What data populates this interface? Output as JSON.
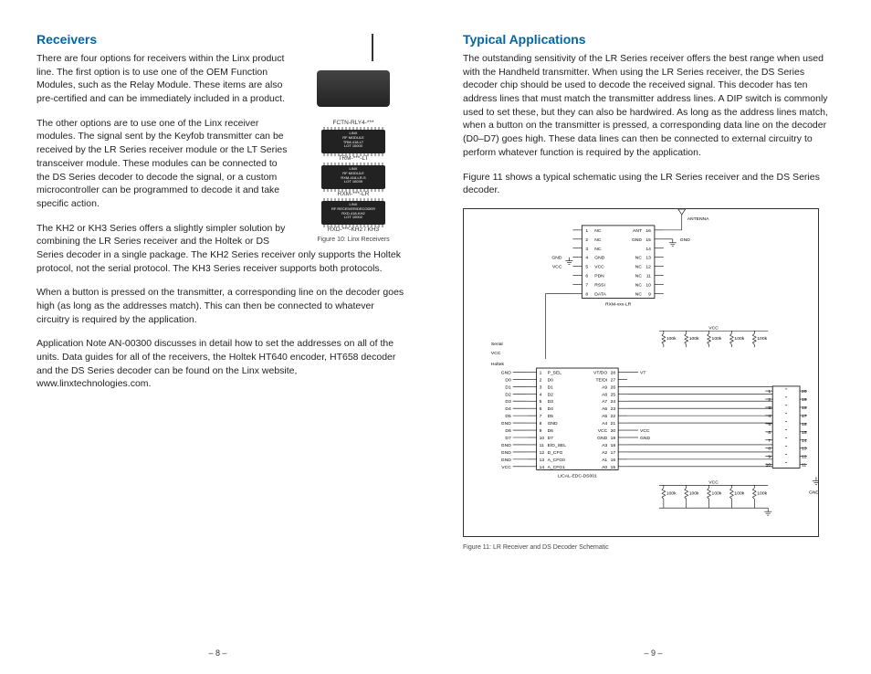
{
  "left": {
    "heading": "Receivers",
    "p1": "There are four options for receivers within the Linx product line. The first option is to use one of the OEM Function Modules, such as the Relay Module. These items are also pre-certified and can be immediately included in a product.",
    "p2": "The other options are to use one of the Linx receiver modules. The signal sent by the Keyfob transmitter can be received by the LR Series receiver module or the LT Series transceiver module. These modules can be connected to the DS Series decoder to decode the signal, or a custom microcontroller can be programmed to decode it and take specific action.",
    "p3": "The KH2 or KH3 Series offers a slightly simpler solution by combining the LR Series receiver and the Holtek or DS Series decoder in a single package. The KH2 Series receiver only supports the Holtek protocol, not the serial protocol. The KH3 Series receiver supports both protocols.",
    "p4": "When a button is pressed on the transmitter, a corresponding line on the decoder goes high (as long as the addresses match). This can then be connected to whatever circuitry is required by the application.",
    "p5": "Application Note AN-00300 discusses in detail how to set the addresses on all of the units. Data guides for all of the receivers, the Holtek HT640 encoder, HT658 decoder and the DS Series decoder can be found on the Linx website, www.linxtechnologies.com.",
    "fig10": {
      "caption": "Figure 10: Linx Receivers",
      "labels": {
        "device": "FCTN-RLY4-***",
        "chip1": "TRM-***-LT",
        "chip1_text": "LINX\nRF MODULE\nTRM-418-LT\nLOT 10000",
        "chip2": "RXM-***-LR",
        "chip2_text": "LINX\nRF MODULE\nRXM-418-LR-S\nLOT 10039",
        "chip3": "RXD-***-KH2 / KH3",
        "chip3_text": "LINX\nRF RECEIVER/DECODER\nRXD-418-KH2\nLOT 10002"
      }
    },
    "pagenum": "– 8 –"
  },
  "right": {
    "heading": "Typical Applications",
    "p1": "The outstanding sensitivity of the LR Series receiver offers the best range when used with the Handheld transmitter. When using the LR Series receiver, the DS Series decoder chip should be used to decode the received signal. This decoder has ten address lines that must match the transmitter address lines. A DIP switch is commonly used to set these, but they can also be hardwired. As long as the address lines match, when a button on the transmitter is pressed, a corresponding data line on the decoder (D0–D7) goes high. These data lines can then be connected to external circuitry to perform whatever function is required by the application.",
    "p2": "Figure 11 shows a typical schematic using the LR Series receiver and the DS Series decoder.",
    "fig11": {
      "caption": "Figure 11: LR Receiver and DS Decoder Schematic",
      "rx_chip": "RXM-xxx-LR",
      "rx_pins_left": [
        "NC",
        "NC",
        "NC",
        "GND",
        "VCC",
        "PDN",
        "RSSI",
        "DATA"
      ],
      "rx_pins_left_nums": [
        "1",
        "2",
        "3",
        "4",
        "5",
        "6",
        "7",
        "8"
      ],
      "rx_pins_right": [
        "ANT",
        "GND",
        "",
        "NC",
        "NC",
        "NC",
        "NC",
        "NC"
      ],
      "rx_pins_right_nums": [
        "16",
        "15",
        "14",
        "13",
        "12",
        "11",
        "10",
        "9"
      ],
      "rx_ext_left_labels": [
        "",
        "",
        "",
        "GND",
        "VCC",
        "",
        "",
        ""
      ],
      "rx_ext_right_label_ant": "ANTENNA",
      "rx_ext_right_label_gnd": "GND",
      "decoder_chip": "LICAL-EDC-DS001",
      "decoder_ext_header_serial": "Serial",
      "decoder_ext_header_holtek": "Holtek",
      "decoder_ext_left": [
        "GND",
        "D0",
        "D1",
        "D2",
        "D3",
        "D4",
        "D5",
        "GND",
        "D6",
        "D7",
        "GND",
        "GND",
        "GND",
        "VCC"
      ],
      "decoder_left_nums": [
        "1",
        "2",
        "3",
        "4",
        "5",
        "6",
        "7",
        "8",
        "9",
        "10",
        "11",
        "12",
        "13",
        "14"
      ],
      "decoder_left_names": [
        "P_SEL",
        "D0",
        "D1",
        "D2",
        "D3",
        "D4",
        "D5",
        "GND",
        "D6",
        "D7",
        "E/D_SEL",
        "D_CFG",
        "A_CFG0",
        "A_CFG1"
      ],
      "decoder_right_names": [
        "VT/DO",
        "TE/DI",
        "A9",
        "A8",
        "A7",
        "A6",
        "A5",
        "A4",
        "VCC",
        "GND",
        "A3",
        "A2",
        "A1",
        "A0"
      ],
      "decoder_right_nums": [
        "28",
        "27",
        "26",
        "25",
        "24",
        "23",
        "22",
        "21",
        "20",
        "19",
        "18",
        "17",
        "16",
        "15"
      ],
      "decoder_ext_right_top": [
        "VT",
        "",
        "",
        "",
        "",
        "",
        "",
        "",
        "VCC",
        "GND",
        "",
        "",
        "",
        ""
      ],
      "resistors": "100k",
      "vcc_label": "VCC",
      "gnd_label": "GND",
      "conn_left_nums": [
        "1",
        "2",
        "3",
        "4",
        "5",
        "6",
        "7",
        "8",
        "9",
        "10"
      ],
      "conn_right_nums": [
        "20",
        "19",
        "18",
        "17",
        "16",
        "15",
        "14",
        "13",
        "12",
        "11"
      ]
    },
    "pagenum": "– 9 –"
  }
}
